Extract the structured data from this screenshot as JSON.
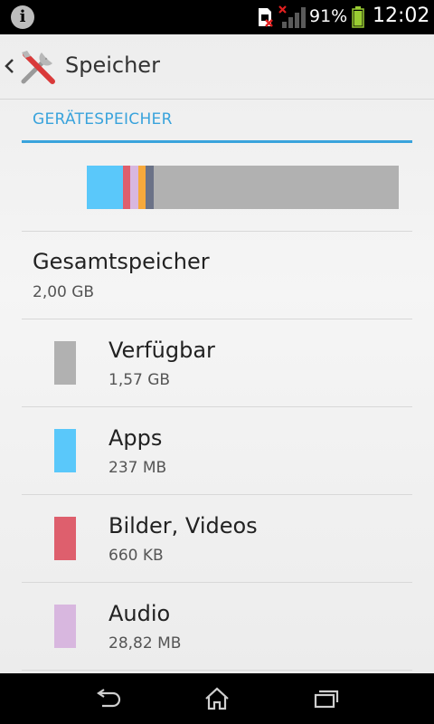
{
  "status_bar": {
    "battery_percent": "91%",
    "time": "12:02",
    "icons": [
      "info-icon",
      "sim-card-icon",
      "signal-icon",
      "battery-icon"
    ]
  },
  "action_bar": {
    "title": "Speicher",
    "icons": [
      "back-icon",
      "tools-icon"
    ]
  },
  "section": {
    "header": "GERÄTESPEICHER"
  },
  "storage_bar": {
    "segments": [
      {
        "name": "apps",
        "color": "#5ac8fa",
        "fraction": 0.117
      },
      {
        "name": "pictures-videos",
        "color": "#de5f6d",
        "fraction": 0.023
      },
      {
        "name": "audio",
        "color": "#d8b7df",
        "fraction": 0.026
      },
      {
        "name": "downloads",
        "color": "#f7a93b",
        "fraction": 0.023
      },
      {
        "name": "misc",
        "color": "#6b7287",
        "fraction": 0.026
      },
      {
        "name": "available",
        "color": "#b1b1b1",
        "fraction": 0.785
      }
    ]
  },
  "total": {
    "label": "Gesamtspeicher",
    "value": "2,00 GB"
  },
  "items": [
    {
      "label": "Verfügbar",
      "value": "1,57 GB",
      "color": "#b1b1b1"
    },
    {
      "label": "Apps",
      "value": "237 MB",
      "color": "#5ac8fa"
    },
    {
      "label": "Bilder, Videos",
      "value": "660 KB",
      "color": "#de5f6d"
    },
    {
      "label": "Audio",
      "value": "28,82 MB",
      "color": "#d8b7df"
    }
  ],
  "nav_bar": {
    "icons": [
      "back-nav-icon",
      "home-icon",
      "recent-apps-icon"
    ]
  }
}
